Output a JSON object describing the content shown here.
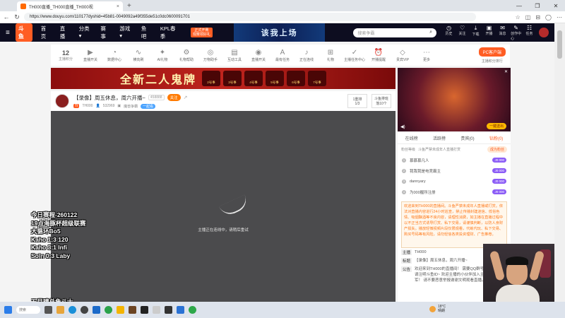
{
  "browser": {
    "tab_title": "TH000直播_TH000直播_TH000视",
    "tab_close": "×",
    "new_tab": "+",
    "window_controls": [
      "—",
      "❐",
      "✕"
    ],
    "url": "https://www.douyu.com/110177dyshid=45b81-0049092a49f355de51c0dc0600091701"
  },
  "site": {
    "logo": "斗鱼",
    "nav": [
      "首页",
      "直播",
      "分类▾",
      "赛事",
      "游戏▾",
      "鱼吧",
      "KPL春季"
    ],
    "badge": "正式开赛\n观赛领好礼",
    "banner_title": "该我上场",
    "search_placeholder": "搜索争霸",
    "header_icons": [
      {
        "name": "history-icon",
        "label": "历史",
        "glyph": "◷"
      },
      {
        "name": "follow-icon",
        "label": "关注",
        "glyph": "♡"
      },
      {
        "name": "download-icon",
        "label": "下载",
        "glyph": "⤓"
      },
      {
        "name": "open-live-icon",
        "label": "开播",
        "glyph": "▣"
      },
      {
        "name": "message-icon",
        "label": "消息",
        "glyph": "✉"
      },
      {
        "name": "creator-center-icon",
        "label": "创作中心",
        "glyph": "✎"
      },
      {
        "name": "task-icon",
        "label": "任务",
        "glyph": "☷"
      }
    ]
  },
  "toolbar": {
    "level": "12",
    "level_label": "主播积分",
    "items": [
      {
        "name": "live-open-icon",
        "label": "直播开关",
        "glyph": "▶"
      },
      {
        "name": "data-center-icon",
        "label": "数据中心",
        "glyph": "◔"
      },
      {
        "name": "wave-icon",
        "label": "横向刷",
        "glyph": "∿"
      },
      {
        "name": "ai-clip-icon",
        "label": "AI礼物",
        "glyph": "✦"
      },
      {
        "name": "gift-help-icon",
        "label": "礼物帮助",
        "glyph": "⚙"
      },
      {
        "name": "assistant-icon",
        "label": "万物助手",
        "glyph": "◎"
      },
      {
        "name": "interact-icon",
        "label": "互动工具",
        "glyph": "▤"
      },
      {
        "name": "live-record-icon",
        "label": "直播开关",
        "glyph": "◉"
      },
      {
        "name": "ab-icon",
        "label": "最有任务",
        "glyph": "A"
      },
      {
        "name": "mic-icon",
        "label": "正在连线",
        "glyph": "♪"
      },
      {
        "name": "gift-icon",
        "label": "礼物",
        "glyph": "⊞"
      },
      {
        "name": "task-center-icon",
        "label": "主播任务中心",
        "glyph": "✓"
      },
      {
        "name": "alarm-icon",
        "label": "开播提醒",
        "glyph": "⏰"
      },
      {
        "name": "diamond-icon",
        "label": "贵宾VIP",
        "glyph": "◇"
      },
      {
        "name": "more-icon",
        "label": "更多",
        "glyph": "⋯"
      }
    ],
    "pc_client": "PC客户端",
    "pc_client_sub": "主播积分排行"
  },
  "promo": {
    "title": "全新二人鬼牌",
    "days": [
      "2号事",
      "3号事",
      "4号事",
      "5号事",
      "6号事",
      "7号事"
    ]
  },
  "room": {
    "title": "【录像】周五休息，周六开播~",
    "hot": "458888",
    "follow": "关注",
    "level": "TI",
    "owner": "TH000",
    "fans": "532969",
    "category": "魔兽争霸",
    "tag": "一起看",
    "rank1_label": "1重排",
    "rank1_value": "1/3",
    "rank2_label": "斗鱼排班",
    "rank2_value": "落10个"
  },
  "player": {
    "message": "主播正在连线中，请稍后重试"
  },
  "overlay": {
    "lines": [
      "今日赛程-260122",
      "19点海豚杯超级联赛",
      "大循环Bo5",
      "Kaho 1:3 120",
      "Kaho 3:1 Infi",
      "Soin 0:3 Laby"
    ],
    "lines2": [
      "五月晴总角斗士",
      "彩色 1:0 Sok"
    ]
  },
  "side": {
    "gift_button": "一键送出",
    "mute": "◀)",
    "close": "✕",
    "tabs": [
      "在线榜",
      "活跃榜",
      "贵宾(0)",
      "钻粉(0)"
    ],
    "fans_label": "粉丝等级",
    "fans_hint": "斗鱼严禁未成年人直播打赏",
    "fans_open": "成为粉丝",
    "fans": [
      {
        "no": "1",
        "name": "慕慕慕凡人",
        "pill": "J0 000"
      },
      {
        "no": "2",
        "name": "我我我是电竞霸主",
        "pill": "J0 000"
      },
      {
        "no": "3",
        "name": "dannyary",
        "pill": "J0 000"
      },
      {
        "no": "4",
        "name": "为000握所注册",
        "pill": "J0 000"
      }
    ],
    "notice": "欢迎来到TH000的直播间。斗鱼严禁未成年人直播或打赏。依法对直播内容进行24小时巡查，禁止传播封建迷信、低俗色情、吸烟酗酒等不良内容，请理性消费，如主播在直播过程中以不正当方式诱导打赏、私下交易，请谨慎判断，以防人身财产损失。播放轻微视频片段仅限观看，代练代玩、私下交易、购买号码等有风险，请勿轻信各类投资理财、广告推荐。",
    "info": [
      {
        "tag": "主播",
        "text": "TH000"
      },
      {
        "tag": "标题",
        "text": "【录像】周五休息，周六开播~"
      },
      {
        "tag": "公告",
        "text": "欢迎来到TH000的直播间！ 需要QQ群号 0、入群申请请注明斗鱼ID~ 欢迎主播的小伙伴加入主播的\"000\"大军！ 请不要恶意举报谢谢文明观看直播。"
      }
    ]
  },
  "taskbar": {
    "search": "搜索",
    "weather_temp": "18°C",
    "weather_text": "晴朗"
  },
  "colors": {
    "brand": "#ff5d23",
    "header_bg": "#0d0d20",
    "player_bg": "#4b4b4d"
  }
}
